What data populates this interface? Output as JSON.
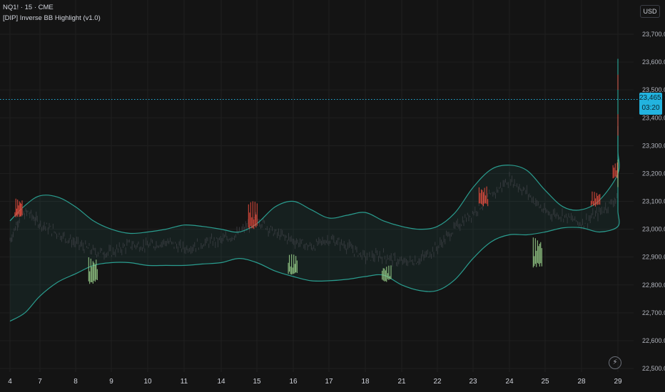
{
  "header": {
    "symbol_line": "NQ1! · 15 · CME",
    "indicator_name": "[DIP] Inverse BB Highlight (v1.0)"
  },
  "currency_button": "USD",
  "current_price": {
    "value": "23,465.75",
    "countdown": "03:20"
  },
  "icons": {
    "flash": "lightning-icon"
  },
  "colors": {
    "background": "#141414",
    "grid": "#1f1f1f",
    "band_stroke": "#2a9d8f",
    "band_fill": "rgba(42,157,143,0.09)",
    "candle": "#3c3f44",
    "high_tail": "#e04a3c",
    "low_tail": "#9bd38c",
    "price_line": "#22b3df",
    "price_tag": "#22b3df"
  },
  "chart_data": {
    "type": "line",
    "title": "",
    "xlabel": "",
    "ylabel": "",
    "x_ticks": [
      "4",
      "7",
      "8",
      "9",
      "10",
      "11",
      "14",
      "15",
      "16",
      "17",
      "18",
      "21",
      "22",
      "23",
      "24",
      "25",
      "28",
      "29"
    ],
    "y_ticks": [
      "22,500.00",
      "22,600.00",
      "22,700.00",
      "22,800.00",
      "22,900.00",
      "23,000.00",
      "23,100.00",
      "23,200.00",
      "23,300.00",
      "23,400.00",
      "23,500.00",
      "23,600.00",
      "23,700.00"
    ],
    "ylim": [
      22500,
      23700
    ],
    "grid": true,
    "series": [
      {
        "role": "upper_band",
        "points": [
          [
            3.0,
            23030
          ],
          [
            3.5,
            23085
          ],
          [
            4.0,
            23120
          ],
          [
            4.5,
            23115
          ],
          [
            5.0,
            23080
          ],
          [
            5.5,
            23030
          ],
          [
            6.0,
            23000
          ],
          [
            6.5,
            22985
          ],
          [
            7.0,
            22990
          ],
          [
            7.5,
            23000
          ],
          [
            8.0,
            23015
          ],
          [
            8.5,
            23010
          ],
          [
            9.0,
            23000
          ],
          [
            9.5,
            22990
          ],
          [
            10.0,
            23020
          ],
          [
            10.5,
            23080
          ],
          [
            11.0,
            23100
          ],
          [
            11.5,
            23070
          ],
          [
            12.0,
            23040
          ],
          [
            12.5,
            23050
          ],
          [
            13.0,
            23060
          ],
          [
            13.5,
            23030
          ],
          [
            14.0,
            23010
          ],
          [
            14.5,
            23000
          ],
          [
            15.0,
            23010
          ],
          [
            15.5,
            23060
          ],
          [
            16.0,
            23150
          ],
          [
            16.5,
            23215
          ],
          [
            17.0,
            23230
          ],
          [
            17.5,
            23210
          ],
          [
            18.0,
            23140
          ],
          [
            18.5,
            23080
          ],
          [
            19.0,
            23070
          ],
          [
            19.5,
            23105
          ],
          [
            20.0,
            23200
          ],
          [
            20.5,
            23280
          ],
          [
            21.0,
            23340
          ],
          [
            21.5,
            23355
          ],
          [
            22.0,
            23350
          ],
          [
            22.5,
            23345
          ],
          [
            23.0,
            23380
          ],
          [
            23.5,
            23410
          ],
          [
            24.0,
            23420
          ],
          [
            24.5,
            23425
          ],
          [
            25.0,
            23450
          ],
          [
            25.5,
            23460
          ],
          [
            26.0,
            23445
          ],
          [
            26.5,
            23430
          ],
          [
            27.0,
            23395
          ],
          [
            27.5,
            23370
          ],
          [
            28.0,
            23410
          ],
          [
            28.5,
            23465
          ],
          [
            29.0,
            23490
          ],
          [
            29.5,
            23490
          ],
          [
            30.0,
            23475
          ],
          [
            30.5,
            23465
          ],
          [
            31.0,
            23510
          ],
          [
            31.5,
            23580
          ],
          [
            32.0,
            23610
          ],
          [
            32.3,
            23600
          ]
        ]
      },
      {
        "role": "lower_band",
        "points": [
          [
            3.0,
            22670
          ],
          [
            3.5,
            22700
          ],
          [
            4.0,
            22760
          ],
          [
            4.5,
            22810
          ],
          [
            5.0,
            22840
          ],
          [
            5.5,
            22870
          ],
          [
            6.0,
            22880
          ],
          [
            6.5,
            22880
          ],
          [
            7.0,
            22870
          ],
          [
            7.5,
            22870
          ],
          [
            8.0,
            22870
          ],
          [
            8.5,
            22875
          ],
          [
            9.0,
            22880
          ],
          [
            9.5,
            22895
          ],
          [
            10.0,
            22880
          ],
          [
            10.5,
            22850
          ],
          [
            11.0,
            22830
          ],
          [
            11.5,
            22815
          ],
          [
            12.0,
            22815
          ],
          [
            12.5,
            22820
          ],
          [
            13.0,
            22830
          ],
          [
            13.5,
            22835
          ],
          [
            14.0,
            22800
          ],
          [
            14.5,
            22780
          ],
          [
            15.0,
            22780
          ],
          [
            15.5,
            22820
          ],
          [
            16.0,
            22895
          ],
          [
            16.5,
            22955
          ],
          [
            17.0,
            22980
          ],
          [
            17.5,
            22980
          ],
          [
            18.0,
            22990
          ],
          [
            18.5,
            23005
          ],
          [
            19.0,
            23005
          ],
          [
            19.5,
            22990
          ],
          [
            20.0,
            23010
          ],
          [
            20.5,
            23065
          ],
          [
            21.0,
            23120
          ],
          [
            21.5,
            23175
          ],
          [
            22.0,
            23205
          ],
          [
            22.5,
            23215
          ],
          [
            23.0,
            23205
          ],
          [
            23.5,
            23180
          ],
          [
            24.0,
            23175
          ],
          [
            24.5,
            23195
          ],
          [
            25.0,
            23235
          ],
          [
            25.5,
            23240
          ],
          [
            26.0,
            23245
          ],
          [
            26.5,
            23220
          ],
          [
            27.0,
            23210
          ],
          [
            27.5,
            23180
          ],
          [
            28.0,
            23180
          ],
          [
            28.5,
            23240
          ],
          [
            29.0,
            23310
          ],
          [
            29.5,
            23360
          ],
          [
            30.0,
            23360
          ],
          [
            30.5,
            23350
          ],
          [
            31.0,
            23320
          ],
          [
            31.5,
            23325
          ],
          [
            32.0,
            23345
          ],
          [
            32.3,
            23370
          ]
        ]
      },
      {
        "role": "price",
        "points": [
          [
            3.0,
            22960
          ],
          [
            3.3,
            23040
          ],
          [
            3.6,
            23060
          ],
          [
            4.0,
            23020
          ],
          [
            4.5,
            22985
          ],
          [
            5.0,
            22950
          ],
          [
            5.5,
            22920
          ],
          [
            6.0,
            22915
          ],
          [
            6.5,
            22945
          ],
          [
            7.0,
            22940
          ],
          [
            7.5,
            22955
          ],
          [
            8.0,
            22930
          ],
          [
            8.5,
            22950
          ],
          [
            9.0,
            22960
          ],
          [
            9.5,
            22985
          ],
          [
            10.0,
            23040
          ],
          [
            10.5,
            22985
          ],
          [
            11.0,
            22960
          ],
          [
            11.5,
            22935
          ],
          [
            12.0,
            22965
          ],
          [
            12.5,
            22940
          ],
          [
            13.0,
            22900
          ],
          [
            13.5,
            22905
          ],
          [
            14.0,
            22880
          ],
          [
            14.5,
            22890
          ],
          [
            15.0,
            22935
          ],
          [
            15.5,
            23005
          ],
          [
            16.0,
            23060
          ],
          [
            16.5,
            23120
          ],
          [
            17.0,
            23180
          ],
          [
            17.5,
            23130
          ],
          [
            18.0,
            23060
          ],
          [
            18.5,
            23050
          ],
          [
            19.0,
            23020
          ],
          [
            19.5,
            23060
          ],
          [
            20.0,
            23115
          ],
          [
            20.5,
            23200
          ],
          [
            21.0,
            23240
          ],
          [
            21.5,
            23265
          ],
          [
            22.0,
            23270
          ],
          [
            22.5,
            23285
          ],
          [
            23.0,
            23330
          ],
          [
            23.5,
            23330
          ],
          [
            24.0,
            23290
          ],
          [
            24.5,
            23280
          ],
          [
            25.0,
            23260
          ],
          [
            25.5,
            23290
          ],
          [
            26.0,
            23360
          ],
          [
            26.5,
            23380
          ],
          [
            27.0,
            23390
          ],
          [
            27.5,
            23365
          ],
          [
            28.0,
            23370
          ],
          [
            28.5,
            23400
          ],
          [
            29.0,
            23420
          ],
          [
            29.5,
            23395
          ],
          [
            30.0,
            23410
          ],
          [
            30.5,
            23410
          ],
          [
            31.0,
            23500
          ],
          [
            31.5,
            23550
          ],
          [
            32.0,
            23495
          ],
          [
            32.3,
            23466
          ]
        ]
      }
    ],
    "highlights": [
      {
        "type": "high",
        "x": 3.3,
        "from": 23040,
        "to": 23110
      },
      {
        "type": "high",
        "x": 9.9,
        "from": 23000,
        "to": 23100
      },
      {
        "type": "high",
        "x": 16.3,
        "from": 23080,
        "to": 23155
      },
      {
        "type": "high",
        "x": 19.4,
        "from": 23080,
        "to": 23135
      },
      {
        "type": "high",
        "x": 20.0,
        "from": 23180,
        "to": 23240
      },
      {
        "type": "high",
        "x": 23.5,
        "from": 23335,
        "to": 23415
      },
      {
        "type": "high",
        "x": 26.5,
        "from": 23355,
        "to": 23410
      },
      {
        "type": "high",
        "x": 30.8,
        "from": 23500,
        "to": 23555
      },
      {
        "type": "low",
        "x": 5.5,
        "from": 22800,
        "to": 22900
      },
      {
        "type": "low",
        "x": 11.0,
        "from": 22835,
        "to": 22910
      },
      {
        "type": "low",
        "x": 13.6,
        "from": 22810,
        "to": 22870
      },
      {
        "type": "low",
        "x": 17.8,
        "from": 22860,
        "to": 22970
      },
      {
        "type": "low",
        "x": 24.3,
        "from": 23150,
        "to": 23250
      }
    ],
    "current_price": 23465.75
  }
}
